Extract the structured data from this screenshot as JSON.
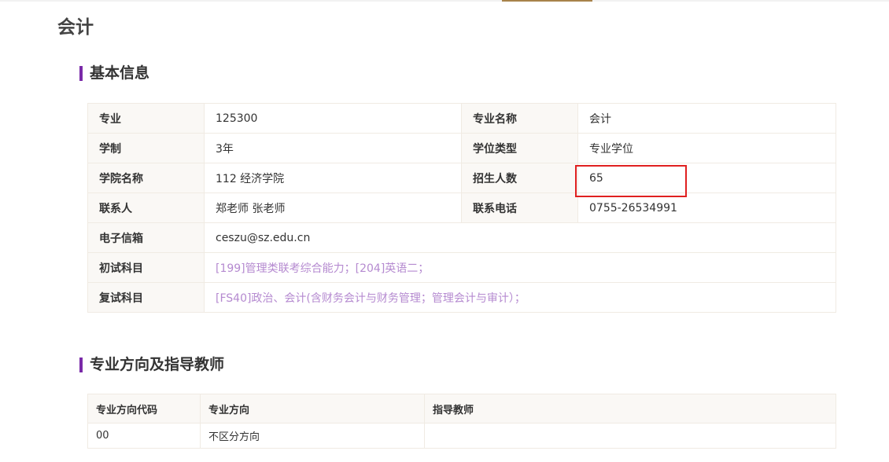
{
  "page": {
    "title": "会计"
  },
  "basic_info": {
    "heading": "基本信息",
    "rows": [
      {
        "l1": "专业",
        "v1": "125300",
        "l2": "专业名称",
        "v2": "会计"
      },
      {
        "l1": "学制",
        "v1": "3年",
        "l2": "学位类型",
        "v2": "专业学位"
      },
      {
        "l1": "学院名称",
        "v1": "112 经济学院",
        "l2": "招生人数",
        "v2": "65"
      },
      {
        "l1": "联系人",
        "v1": "郑老师 张老师",
        "l2": "联系电话",
        "v2": "0755-26534991"
      }
    ],
    "email_label": "电子信箱",
    "email_value": "ceszu@sz.edu.cn",
    "prelim_label": "初试科目",
    "prelim_value": "[199]管理类联考综合能力；[204]英语二；",
    "retest_label": "复试科目",
    "retest_value": "[FS40]政治、会计(含财务会计与财务管理；管理会计与审计）；"
  },
  "directions": {
    "heading": "专业方向及指导教师",
    "columns": [
      "专业方向代码",
      "专业方向",
      "指导教师"
    ],
    "rows": [
      {
        "code": "00",
        "direction": "不区分方向",
        "advisor": ""
      }
    ]
  },
  "colors": {
    "accent_bar": "#7a2aa8",
    "link_purple": "#b58ad0",
    "highlight_red": "#e02020",
    "label_bg": "#faf8f5"
  }
}
